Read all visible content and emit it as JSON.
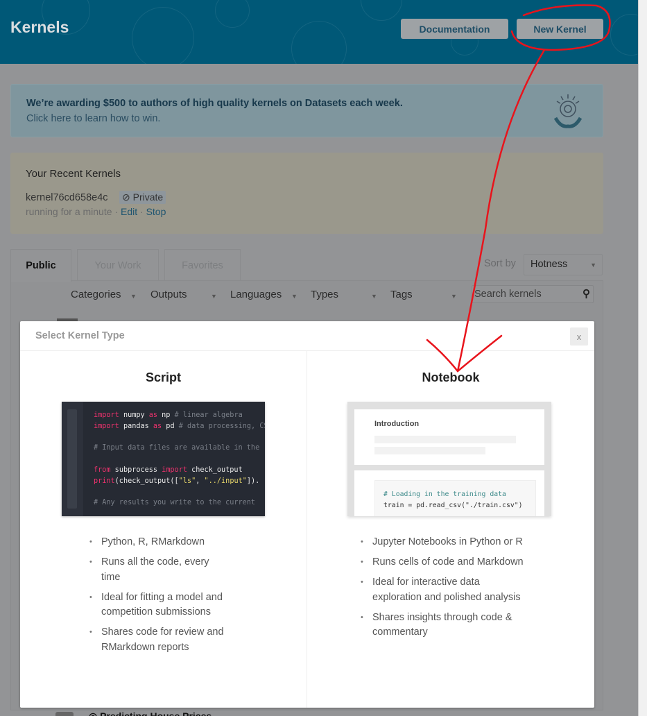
{
  "header": {
    "title": "Kernels",
    "documentation_label": "Documentation",
    "new_kernel_label": "New Kernel"
  },
  "banner": {
    "headline": "We’re awarding $500 to authors of high quality kernels on Datasets each week.",
    "link": "Click here to learn how to win."
  },
  "recent": {
    "heading": "Your Recent Kernels",
    "kernel_name": "kernel76cd658e4c",
    "visibility": "Private",
    "status": "running for a minute",
    "sep": " · ",
    "edit": "Edit",
    "stop": "Stop"
  },
  "tabs": [
    {
      "label": "Public",
      "active": true
    },
    {
      "label": "Your Work"
    },
    {
      "label": "Favorites"
    }
  ],
  "sort": {
    "label": "Sort by",
    "value": "Hotness"
  },
  "filters": [
    "Categories",
    "Outputs",
    "Languages",
    "Types",
    "Tags"
  ],
  "search": {
    "placeholder": "Search kernels"
  },
  "partial_row": {
    "title": "Predicting House Prices"
  },
  "modal": {
    "title": "Select Kernel Type",
    "close": "x",
    "script": {
      "title": "Script",
      "bullets": [
        "Python, R, RMarkdown",
        "Runs all the code, every time",
        "Ideal for fitting a model and competition submissions",
        "Shares code for review and RMarkdown reports"
      ]
    },
    "notebook": {
      "title": "Notebook",
      "preview_heading": "Introduction",
      "preview_comment": "# Loading in the training data",
      "preview_code": "train = pd.read_csv(\"./train.csv\")",
      "bullets": [
        "Jupyter Notebooks in Python or R",
        "Runs cells of code and Markdown",
        "Ideal for interactive data exploration and polished analysis",
        "Shares insights through code & commentary"
      ]
    }
  },
  "annotation_color": "#e8141c"
}
